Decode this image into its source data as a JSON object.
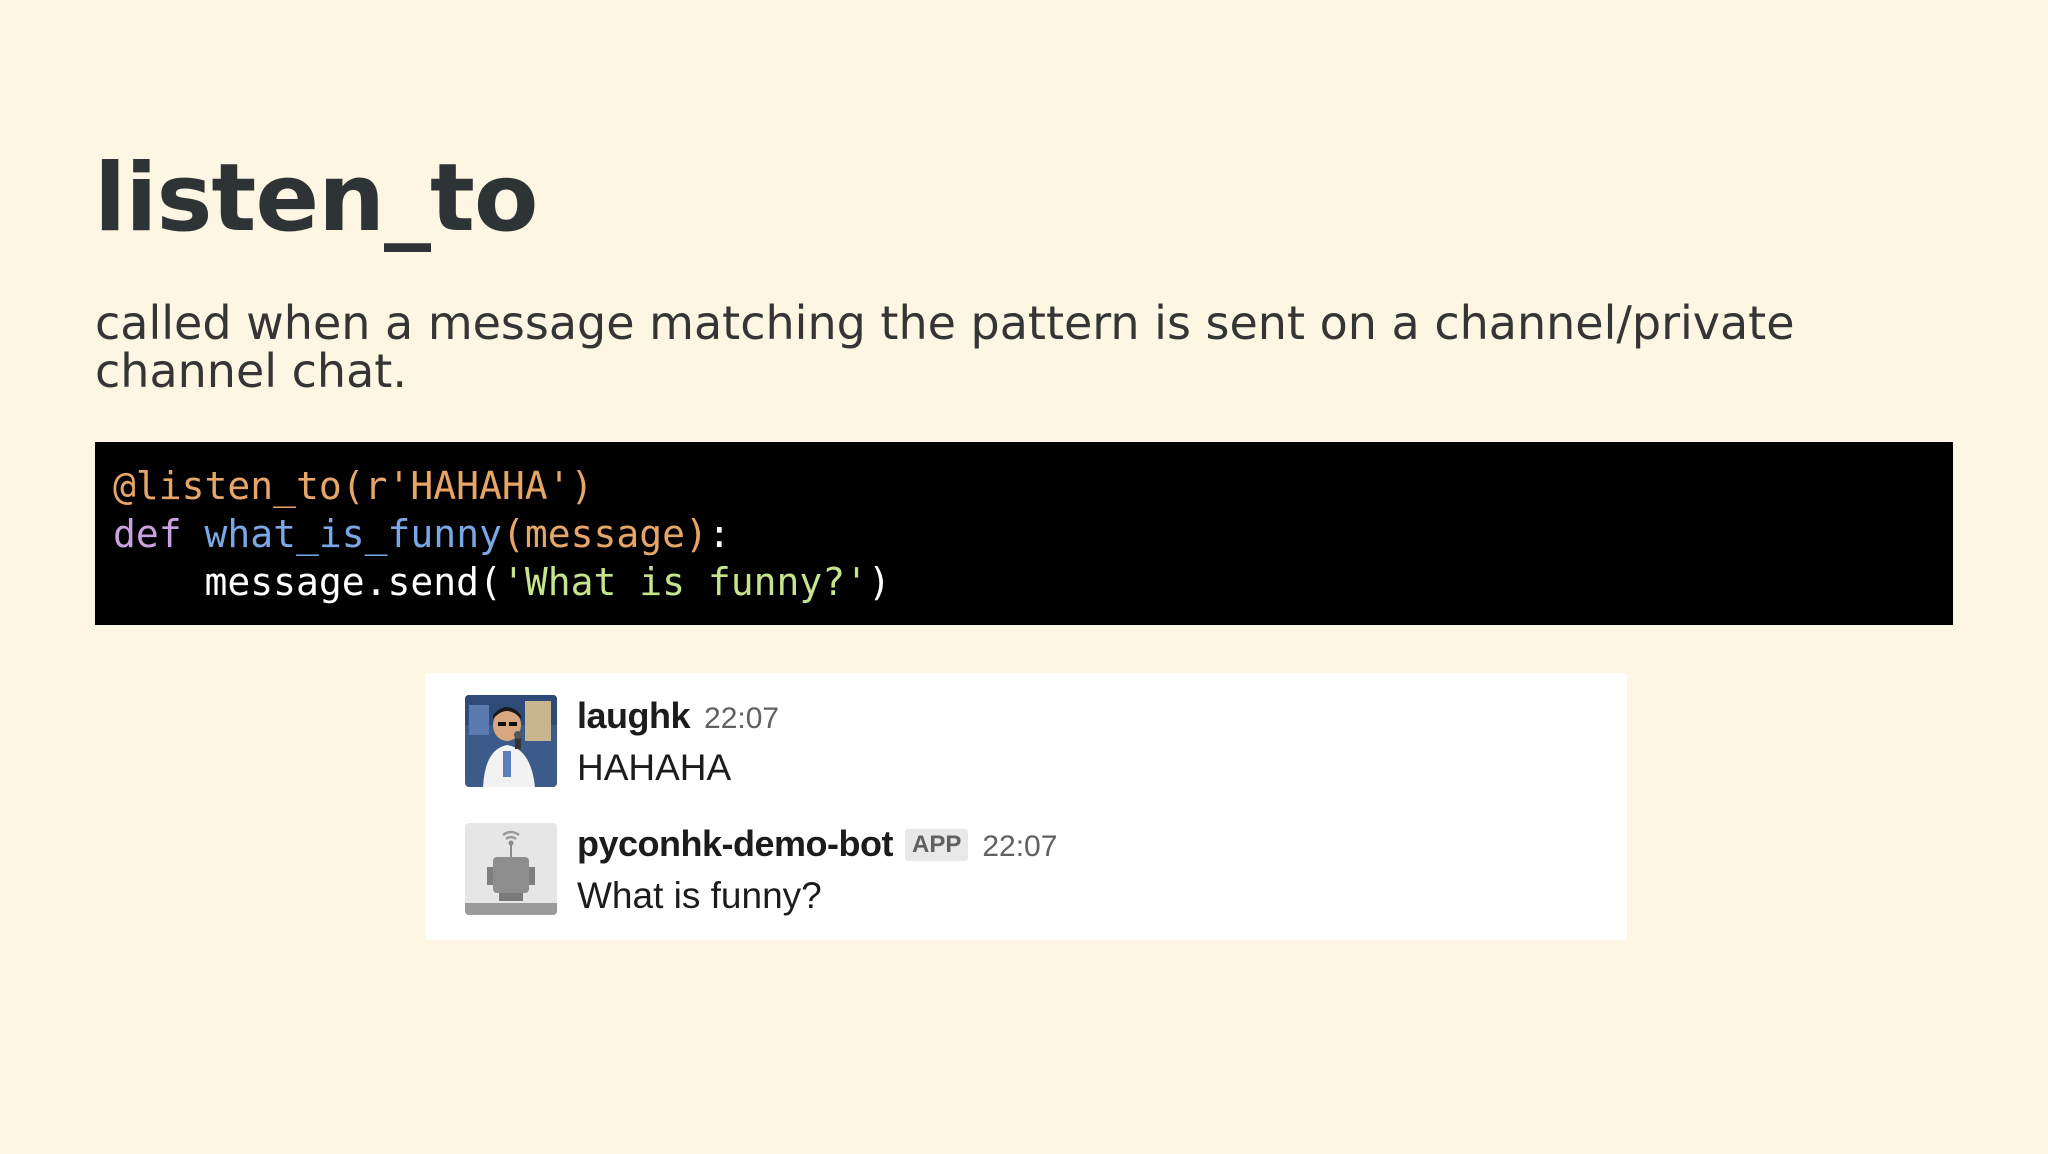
{
  "slide": {
    "title": "listen_to",
    "subtitle": "called when a message matching the pattern is sent on a channel/private channel chat."
  },
  "code": {
    "decorator": "@listen_to(r'HAHAHA')",
    "def_kw": "def",
    "func_name": "what_is_funny",
    "paren_open": "(",
    "param": "message",
    "paren_close_colon": "):",
    "colon": ":",
    "indent": "    ",
    "call": "message.send(",
    "string": "'What is funny?'",
    "call_close": ")"
  },
  "chat": {
    "messages": [
      {
        "name": "laughk",
        "time": "22:07",
        "text": "HAHAHA",
        "avatar": "user-photo-avatar"
      },
      {
        "name": "pyconhk-demo-bot",
        "badge": "APP",
        "time": "22:07",
        "text": "What is funny?",
        "avatar": "robot-avatar-icon"
      }
    ]
  },
  "colors": {
    "background": "#fdf6e3",
    "code_background": "#000000",
    "decorator": "#e8a568",
    "keyword": "#c9a2e0",
    "function": "#7aa7e6",
    "string": "#c6e48b"
  }
}
